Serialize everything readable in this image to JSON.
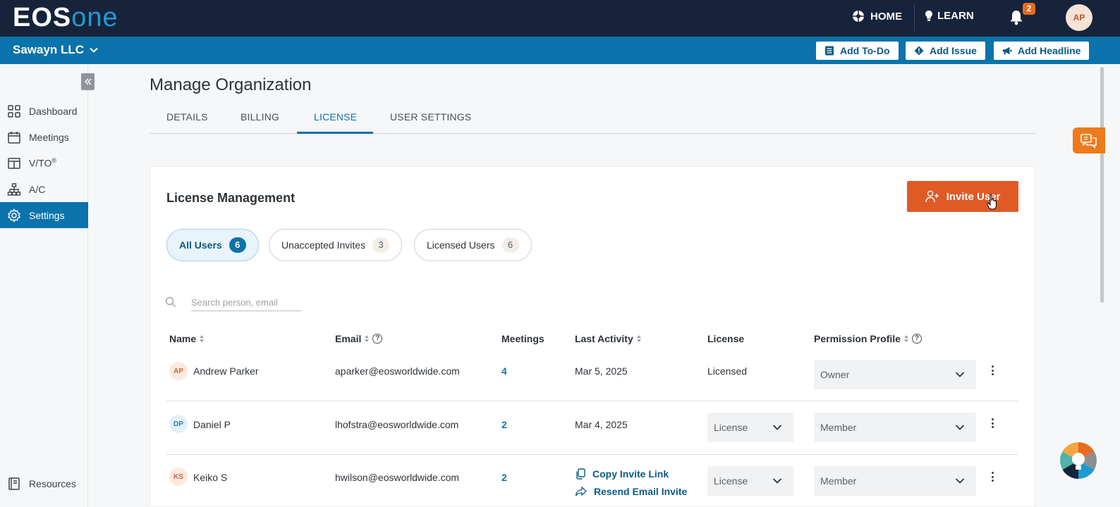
{
  "topbar": {
    "logo_main": "EOS",
    "logo_accent": "one",
    "home_label": "HOME",
    "learn_label": "LEARN",
    "notification_count": "2",
    "avatar_initials": "AP"
  },
  "orgbar": {
    "org_name": "Sawayn LLC",
    "add_todo": "Add To-Do",
    "add_issue": "Add Issue",
    "add_headline": "Add Headline"
  },
  "sidebar": {
    "items": [
      {
        "label": "Dashboard",
        "icon": "grid-icon"
      },
      {
        "label": "Meetings",
        "icon": "calendar-icon"
      },
      {
        "label": "V/TO",
        "sup": "®",
        "icon": "layout-icon"
      },
      {
        "label": "A/C",
        "icon": "org-chart-icon"
      },
      {
        "label": "Settings",
        "icon": "gear-icon",
        "active": true
      }
    ],
    "resources": "Resources"
  },
  "page": {
    "title": "Manage Organization",
    "tabs": [
      "DETAILS",
      "BILLING",
      "LICENSE",
      "USER SETTINGS"
    ],
    "active_tab": "LICENSE"
  },
  "license": {
    "title": "License Management",
    "invite_button": "Invite User",
    "filters": [
      {
        "label": "All Users",
        "count": "6",
        "active": true
      },
      {
        "label": "Unaccepted Invites",
        "count": "3"
      },
      {
        "label": "Licensed Users",
        "count": "6"
      }
    ],
    "search_placeholder": "Search person, email",
    "columns": [
      "Name",
      "Email",
      "Meetings",
      "Last Activity",
      "License",
      "Permission Profile"
    ],
    "rows": [
      {
        "initials": "AP",
        "name": "Andrew Parker",
        "email": "aparker@eosworldwide.com",
        "meetings": "4",
        "last_activity": "Mar 5, 2025",
        "license": "Licensed",
        "permission": "Owner"
      },
      {
        "initials": "DP",
        "name": "Daniel P",
        "email": "lhofstra@eosworldwide.com",
        "meetings": "2",
        "last_activity": "Mar 4, 2025",
        "license": "License",
        "permission": "Member"
      },
      {
        "initials": "KS",
        "name": "Keiko S",
        "email": "hwilson@eosworldwide.com",
        "meetings": "2",
        "copy_invite": "Copy Invite Link",
        "resend_invite": "Resend Email Invite",
        "license": "License",
        "permission": "Member"
      }
    ]
  },
  "colors": {
    "topbar": "#16233a",
    "orgbar": "#0b73ab",
    "accent": "#e05a26",
    "feedback": "#ee7a1a"
  }
}
